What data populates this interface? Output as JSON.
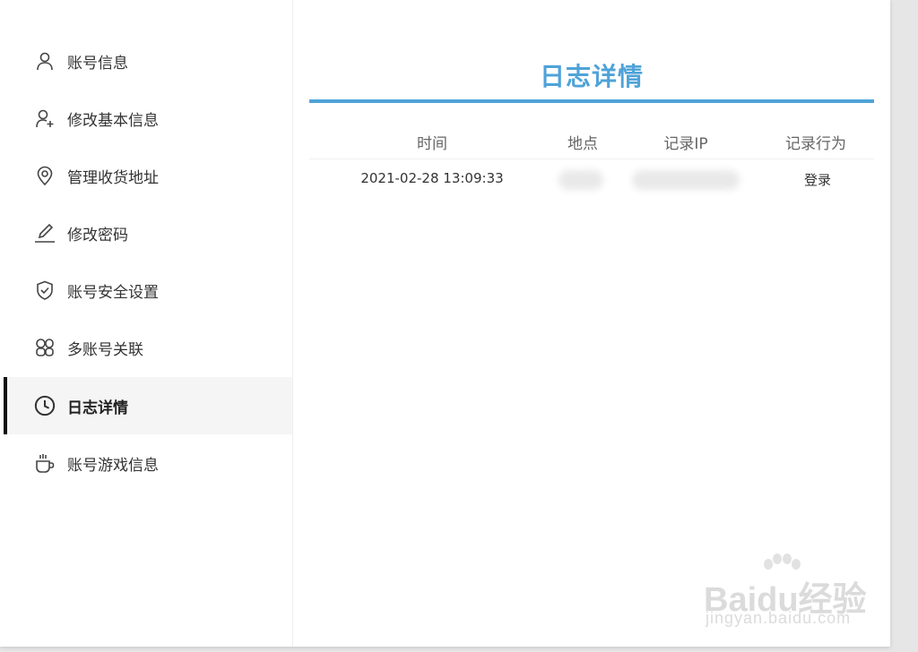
{
  "sidebar": {
    "items": [
      {
        "label": "账号信息",
        "icon": "user-icon"
      },
      {
        "label": "修改基本信息",
        "icon": "user-plus-icon"
      },
      {
        "label": "管理收货地址",
        "icon": "location-pin-icon"
      },
      {
        "label": "修改密码",
        "icon": "pen-icon"
      },
      {
        "label": "账号安全设置",
        "icon": "shield-check-icon"
      },
      {
        "label": "多账号关联",
        "icon": "multi-account-icon"
      },
      {
        "label": "日志详情",
        "icon": "clock-icon",
        "active": true
      },
      {
        "label": "账号游戏信息",
        "icon": "cup-icon"
      }
    ]
  },
  "main": {
    "title": "日志详情",
    "table": {
      "headers": [
        "时间",
        "地点",
        "记录IP",
        "记录行为"
      ],
      "rows": [
        {
          "time": "2021-02-28 13:09:33",
          "location": "",
          "ip": "",
          "action": "登录"
        }
      ]
    }
  },
  "watermark": {
    "brand": "Baidu经验",
    "url": "jingyan.baidu.com"
  },
  "colors": {
    "accent": "#4fa3d8",
    "active_indicator": "#111111",
    "cursor": "#a020f0"
  }
}
